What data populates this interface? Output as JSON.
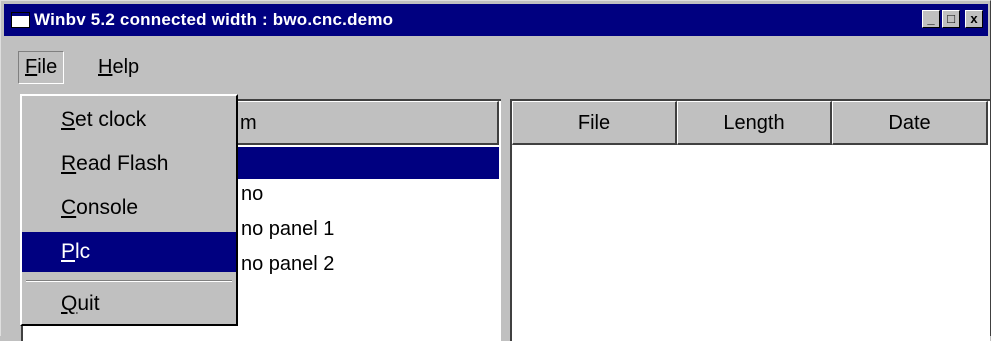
{
  "window": {
    "title": "Winbv 5.2 connected width : bwo.cnc.demo",
    "min_label": "_",
    "max_label": "□",
    "close_label": "x"
  },
  "menubar": {
    "file": "File",
    "help": "Help"
  },
  "file_menu": {
    "items": [
      {
        "label": "Set clock"
      },
      {
        "label": "Read Flash"
      },
      {
        "label": "Console"
      },
      {
        "label": "Plc"
      },
      {
        "label": "Quit"
      }
    ],
    "active_index": 3
  },
  "left_pane": {
    "header_fragment": "m",
    "rows": [
      "no",
      "no panel 1",
      "no panel 2"
    ]
  },
  "right_pane": {
    "columns": [
      "File",
      "Length",
      "Date"
    ]
  },
  "colors": {
    "titlebar": "#000080",
    "face": "#c0c0c0",
    "selection": "#000080"
  }
}
